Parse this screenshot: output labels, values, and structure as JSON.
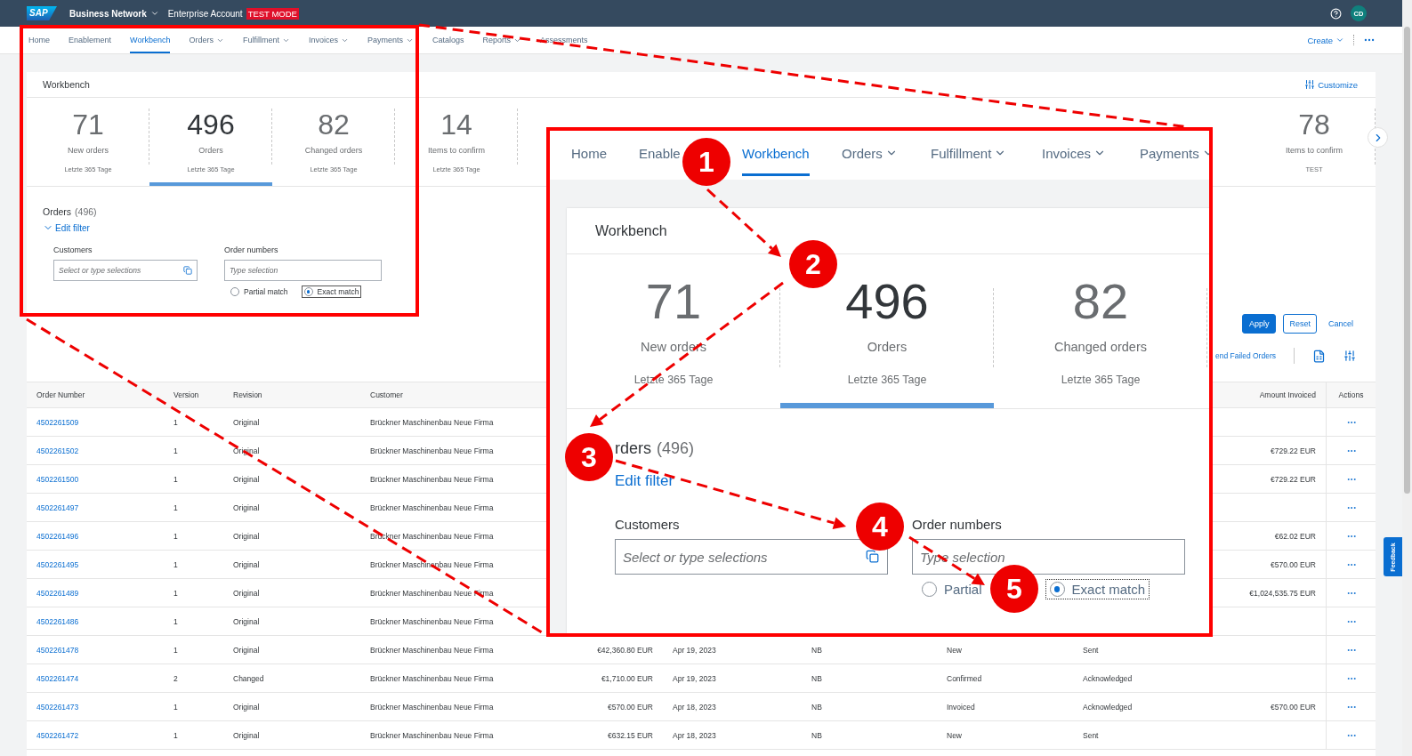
{
  "top_bar": {
    "logo": "SAP",
    "product": "Business Network",
    "account": "Enterprise Account",
    "mode_badge": "TEST MODE",
    "avatar": "CD"
  },
  "nav": {
    "items": [
      {
        "label": "Home",
        "selected": false,
        "dropdown": false
      },
      {
        "label": "Enablement",
        "selected": false,
        "dropdown": false
      },
      {
        "label": "Workbench",
        "selected": true,
        "dropdown": false
      },
      {
        "label": "Orders",
        "selected": false,
        "dropdown": true
      },
      {
        "label": "Fulfillment",
        "selected": false,
        "dropdown": true
      },
      {
        "label": "Invoices",
        "selected": false,
        "dropdown": true
      },
      {
        "label": "Payments",
        "selected": false,
        "dropdown": true
      },
      {
        "label": "Catalogs",
        "selected": false,
        "dropdown": false
      },
      {
        "label": "Reports",
        "selected": false,
        "dropdown": true
      },
      {
        "label": "Assessments",
        "selected": false,
        "dropdown": false
      }
    ],
    "create": "Create"
  },
  "workbench": {
    "title": "Workbench",
    "customize": "Customize",
    "tiles": [
      {
        "value": "71",
        "label": "New orders",
        "period": "Letzte 365 Tage",
        "selected": false
      },
      {
        "value": "496",
        "label": "Orders",
        "period": "Letzte 365 Tage",
        "selected": true
      },
      {
        "value": "82",
        "label": "Changed orders",
        "period": "Letzte 365 Tage",
        "selected": false
      },
      {
        "value": "14",
        "label": "Items to confirm",
        "period": "Letzte 365 Tage",
        "selected": false
      },
      {
        "value": "78",
        "label": "Items to confirm",
        "period": "TEST",
        "selected": false
      }
    ]
  },
  "filter": {
    "title": "Orders",
    "count": "(496)",
    "edit_filter": "Edit filter",
    "expanded": true,
    "customers": {
      "label": "Customers",
      "placeholder": "Select or type selections"
    },
    "order_numbers": {
      "label": "Order numbers",
      "placeholder": "Type selection"
    },
    "match": [
      {
        "label": "Partial match",
        "selected": false
      },
      {
        "label": "Exact match",
        "selected": true
      }
    ],
    "apply": "Apply",
    "reset": "Reset",
    "cancel": "Cancel",
    "resend_link": "end Failed Orders"
  },
  "table": {
    "headers": {
      "order_number": "Order Number",
      "version": "Version",
      "revision": "Revision",
      "customer": "Customer",
      "amount_invoiced": "Amount Invoiced",
      "actions": "Actions"
    },
    "rows": [
      {
        "order_number": "4502261509",
        "version": "1",
        "revision": "Original",
        "customer": "Brückner Maschinenbau Neue Firma"
      },
      {
        "order_number": "4502261502",
        "version": "1",
        "revision": "Original",
        "customer": "Brückner Maschinenbau Neue Firma",
        "amount_invoiced": "€729.22 EUR"
      },
      {
        "order_number": "4502261500",
        "version": "1",
        "revision": "Original",
        "customer": "Brückner Maschinenbau Neue Firma",
        "amount_invoiced": "€729.22 EUR"
      },
      {
        "order_number": "4502261497",
        "version": "1",
        "revision": "Original",
        "customer": "Brückner Maschinenbau Neue Firma"
      },
      {
        "order_number": "4502261496",
        "version": "1",
        "revision": "Original",
        "customer": "Brückner Maschinenbau Neue Firma",
        "amount_invoiced": "€62.02 EUR"
      },
      {
        "order_number": "4502261495",
        "version": "1",
        "revision": "Original",
        "customer": "Brückner Maschinenbau Neue Firma",
        "amount_invoiced": "€570.00 EUR"
      },
      {
        "order_number": "4502261489",
        "version": "1",
        "revision": "Original",
        "customer": "Brückner Maschinenbau Neue Firma",
        "amount_invoiced": "€1,024,535.75 EUR"
      },
      {
        "order_number": "4502261486",
        "version": "1",
        "revision": "Original",
        "customer": "Brückner Maschinenbau Neue Firma"
      },
      {
        "order_number": "4502261478",
        "version": "1",
        "revision": "Original",
        "customer": "Brückner Maschinenbau Neue Firma",
        "column_5": "€42,360.80 EUR",
        "column_6": "Apr 19, 2023",
        "column_7": "NB",
        "column_8": "New",
        "column_9": "Sent"
      },
      {
        "order_number": "4502261474",
        "version": "2",
        "revision": "Changed",
        "customer": "Brückner Maschinenbau Neue Firma",
        "column_5": "€1,710.00 EUR",
        "column_6": "Apr 19, 2023",
        "column_7": "NB",
        "column_8": "Confirmed",
        "column_9": "Acknowledged"
      },
      {
        "order_number": "4502261473",
        "version": "1",
        "revision": "Original",
        "customer": "Brückner Maschinenbau Neue Firma",
        "column_5": "€570.00 EUR",
        "column_6": "Apr 18, 2023",
        "column_7": "NB",
        "column_8": "Invoiced",
        "column_9": "Acknowledged",
        "amount_invoiced": "€570.00 EUR"
      },
      {
        "order_number": "4502261472",
        "version": "1",
        "revision": "Original",
        "customer": "Brückner Maschinenbau Neue Firma",
        "column_5": "€632.15 EUR",
        "column_6": "Apr 18, 2023",
        "column_7": "NB",
        "column_8": "New",
        "column_9": "Sent"
      }
    ]
  },
  "feedback": "Feedback",
  "zoom_inset": {
    "nav": [
      {
        "label": "Home",
        "selected": false,
        "dropdown": false
      },
      {
        "label": "Enable",
        "selected": false,
        "dropdown": false
      },
      {
        "label": "Workbench",
        "selected": true,
        "dropdown": false
      },
      {
        "label": "Orders",
        "selected": false,
        "dropdown": true
      },
      {
        "label": "Fulfillment",
        "selected": false,
        "dropdown": true
      },
      {
        "label": "Invoices",
        "selected": false,
        "dropdown": true
      },
      {
        "label": "Payments",
        "selected": false,
        "dropdown": true
      }
    ],
    "title": "Workbench",
    "tiles": [
      {
        "value": "71",
        "label": "New orders",
        "period": "Letzte 365 Tage",
        "selected": false
      },
      {
        "value": "496",
        "label": "Orders",
        "period": "Letzte 365 Tage",
        "selected": true
      },
      {
        "value": "82",
        "label": "Changed orders",
        "period": "Letzte 365 Tage",
        "selected": false
      }
    ],
    "filter_title": "rders",
    "count": "(496)",
    "edit_filter": "Edit filter",
    "customers": {
      "label": "Customers",
      "placeholder": "Select or type selections"
    },
    "order_numbers": {
      "label": "Order numbers",
      "placeholder": "Type selection"
    },
    "match": [
      {
        "label": "Partial",
        "selected": false
      },
      {
        "label": "Exact match",
        "selected": true
      }
    ]
  },
  "markers": [
    "1",
    "2",
    "3",
    "4",
    "5"
  ]
}
